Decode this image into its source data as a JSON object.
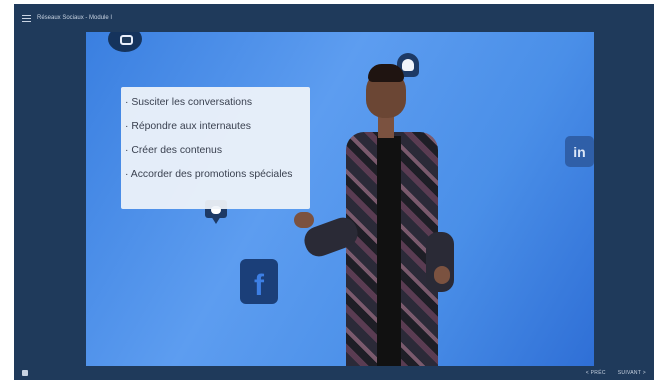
{
  "header": {
    "title": "Réseaux Sociaux - Module I"
  },
  "slide": {
    "bullets": [
      "· Susciter les conversations",
      "· Répondre aux internautes",
      "· Créer des contenus",
      "· Accorder des promotions spéciales"
    ],
    "icons": {
      "linkedin": "in",
      "facebook": "f"
    }
  },
  "footer": {
    "prev_label": "< PRÉC",
    "next_label": "SUIVANT >"
  },
  "colors": {
    "frame": "#1f3a5b",
    "accent": "#3a7fe0"
  }
}
